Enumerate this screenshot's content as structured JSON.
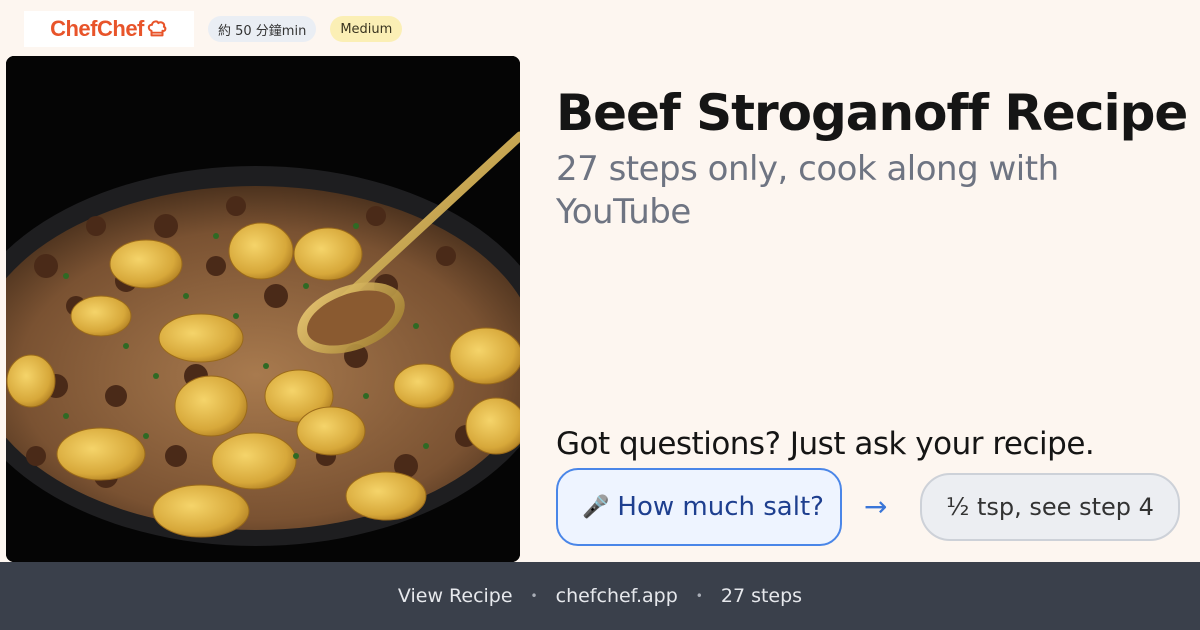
{
  "brand": {
    "name": "ChefChef",
    "icon": "chef-hat-icon",
    "color": "#e8542a"
  },
  "meta": {
    "time": "約 50 分鐘min",
    "difficulty": "Medium"
  },
  "recipe": {
    "title": "Beef Stroganoff Recipe",
    "subtitle": "27 steps only, cook along with YouTube",
    "image_alt": "Skillet of beef stroganoff with potatoes and herbs, golden spoon"
  },
  "chat": {
    "prompt": "Got questions? Just ask your recipe.",
    "question": "How much salt?",
    "question_icon": "microphone-icon",
    "arrow": "→",
    "answer": "½ tsp, see step 4"
  },
  "footer": {
    "link": "View Recipe",
    "separator": "•",
    "site": "chefchef.app",
    "steps": "27 steps"
  },
  "colors": {
    "accent": "#4a86e8",
    "background": "#fdf6f0",
    "footer_bg": "#3a404b"
  }
}
